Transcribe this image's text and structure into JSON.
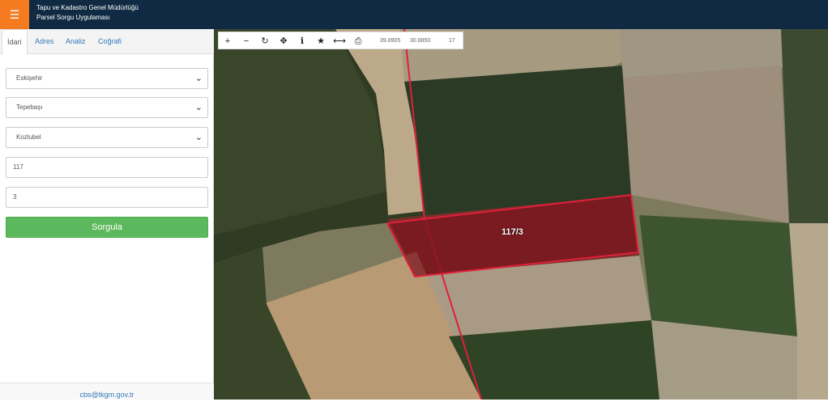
{
  "header": {
    "menu_icon": "☰",
    "title_line1": "Tapu ve Kadastro Genel Müdürlüğü",
    "title_line2": "Parsel Sorgu Uygulaması"
  },
  "tabs": [
    {
      "label": "İdari"
    },
    {
      "label": "Adres"
    },
    {
      "label": "Analiz"
    },
    {
      "label": "Coğrafi"
    }
  ],
  "form": {
    "province": "Eskişehir",
    "district": "Tepebaşı",
    "neighborhood": "Kozlubel",
    "block": "117",
    "parcel": "3",
    "query_button": "Sorgula"
  },
  "footer": {
    "email": "cbs@tkgm.gov.tr"
  },
  "map": {
    "parcel_label": "117/3",
    "coord_lat": "39.8905",
    "coord_lon": "30.8850",
    "zoom": "17",
    "parcel_color": "#c0172c"
  },
  "toolbar_icons": [
    "zoom-in-icon",
    "zoom-out-icon",
    "refresh-icon",
    "locate-icon",
    "info-icon",
    "star-icon",
    "measure-icon",
    "print-icon"
  ]
}
